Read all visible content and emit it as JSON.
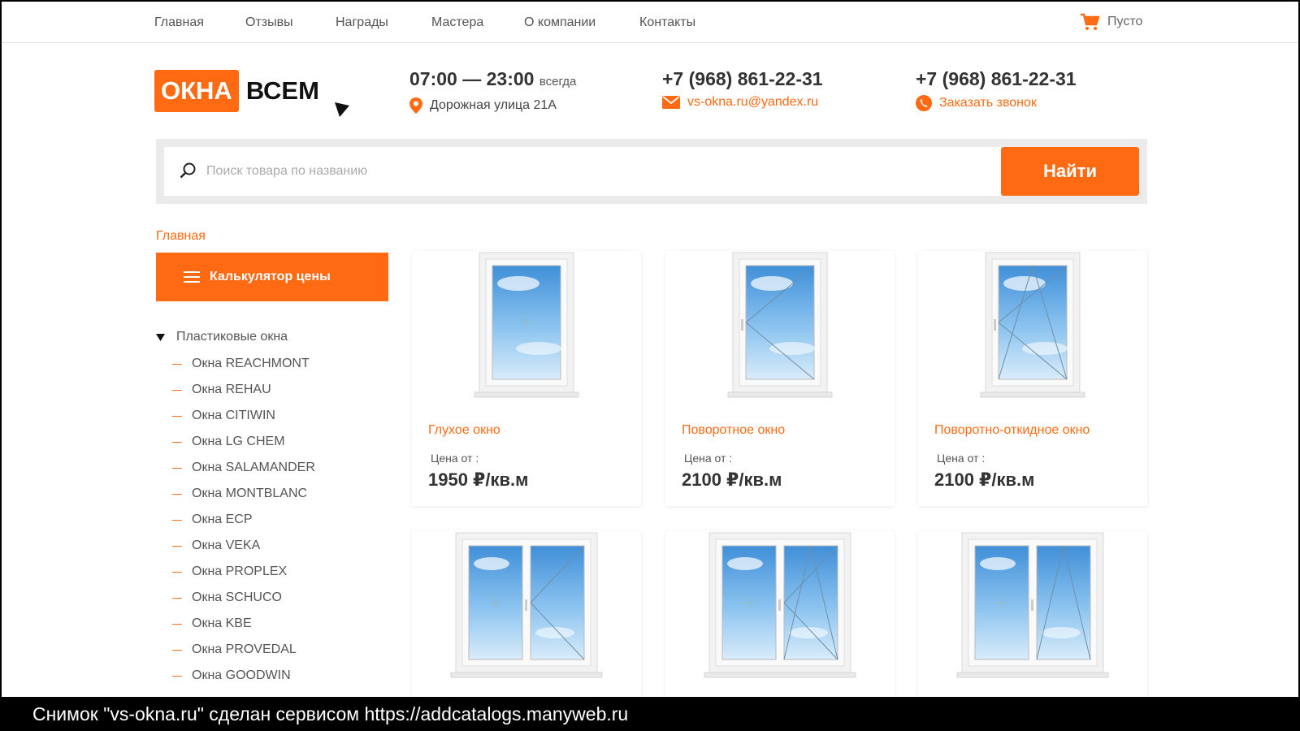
{
  "nav": {
    "items": [
      "Главная",
      "Отзывы",
      "Награды",
      "Мастера",
      "О компании",
      "Контакты"
    ],
    "cart_label": "Пусто"
  },
  "logo": {
    "box_text": "ОКНА",
    "word": "ВСЕМ"
  },
  "header": {
    "hours": "07:00 — 23:00",
    "hours_suffix": "всегда",
    "address": "Дорожная улица 21А",
    "phone1": "+7 (968) 861-22-31",
    "email": "vs-okna.ru@yandex.ru",
    "phone2": "+7 (968) 861-22-31",
    "callback": "Заказать звонок"
  },
  "search": {
    "placeholder": "Поиск товара по названию",
    "button": "Найти"
  },
  "breadcrumb": "Главная",
  "sidebar": {
    "calc_button": "Калькулятор цены",
    "category": "Пластиковые окна",
    "items": [
      "Окна REACHMONT",
      "Окна REHAU",
      "Окна CITIWIN",
      "Окна LG CHEM",
      "Окна SALAMANDER",
      "Окна MONTBLANC",
      "Окна ECP",
      "Окна VEKA",
      "Окна PROPLEX",
      "Окна SCHUCO",
      "Окна KBE",
      "Окна PROVEDAL",
      "Окна GOODWIN"
    ]
  },
  "products": [
    {
      "name": "Глухое окно",
      "price_label": "Цена от :",
      "price": "1950 ₽/кв.м"
    },
    {
      "name": "Поворотное окно",
      "price_label": "Цена от :",
      "price": "2100 ₽/кв.м"
    },
    {
      "name": "Поворотно-откидное окно",
      "price_label": "Цена от :",
      "price": "2100 ₽/кв.м"
    }
  ],
  "colors": {
    "accent": "#ff6a13",
    "text": "#333333",
    "muted": "#555555"
  },
  "caption": "Снимок \"vs-okna.ru\" сделан сервисом https://addcatalogs.manyweb.ru"
}
